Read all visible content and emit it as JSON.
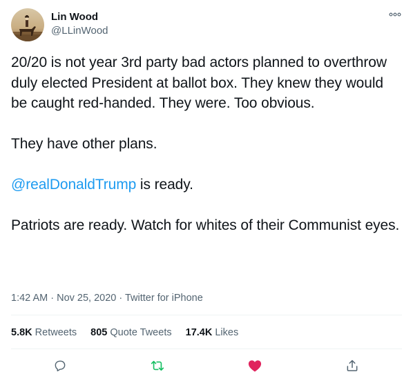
{
  "author": {
    "display_name": "Lin Wood",
    "handle": "@LLinWood",
    "avatar_icon": "avatar-horse-rider"
  },
  "tweet": {
    "line1": "20/20 is not year 3rd party bad actors planned to overthrow duly elected President at ballot box. They knew they would be caught red-handed. They were. Too obvious.",
    "line2": "They have other plans.",
    "mention": "@realDonaldTrump",
    "line3_rest": " is ready.",
    "line4": "Patriots are ready. Watch for whites of their Communist eyes."
  },
  "meta": {
    "time": "1:42 AM",
    "sep1": " · ",
    "date": "Nov 25, 2020",
    "sep2": " · ",
    "source": "Twitter for iPhone"
  },
  "stats": {
    "retweets_count": "5.8K",
    "retweets_label": "Retweets",
    "quotes_count": "805",
    "quotes_label": "Quote Tweets",
    "likes_count": "17.4K",
    "likes_label": "Likes"
  },
  "actions": {
    "reply_icon": "reply-icon",
    "retweet_icon": "retweet-icon",
    "like_icon": "like-icon",
    "share_icon": "share-icon",
    "retweet_color": "#17bf63",
    "like_color": "#e0245e",
    "liked": true,
    "retweeted": true
  },
  "colors": {
    "link": "#1d9bf0",
    "text": "#0f1419",
    "muted": "#536471",
    "divider": "#eff3f4"
  }
}
